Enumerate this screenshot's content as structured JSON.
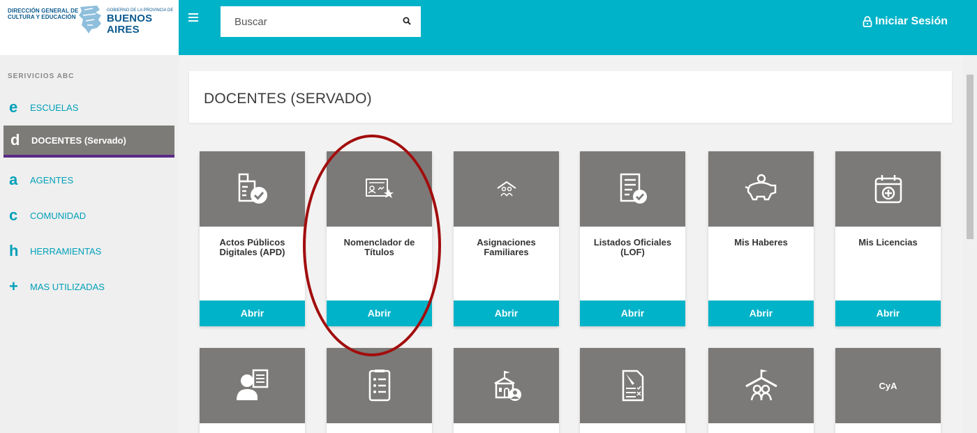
{
  "brand": {
    "left_line1": "DIRECCIÓN GENERAL DE",
    "left_line2": "CULTURA Y EDUCACIÓN",
    "right_small": "GOBIERNO DE LA PROVINCIA DE",
    "right_big": "BUENOS AIRES"
  },
  "sidebar": {
    "section_label": "SERIVICIOS ABC",
    "items": [
      {
        "letter": "e",
        "label": "ESCUELAS"
      },
      {
        "letter": "d",
        "label": "DOCENTES (Servado)"
      },
      {
        "letter": "a",
        "label": "AGENTES"
      },
      {
        "letter": "c",
        "label": "COMUNIDAD"
      },
      {
        "letter": "h",
        "label": "HERRAMIENTAS"
      },
      {
        "letter": "+",
        "label": "MAS UTILIZADAS"
      }
    ]
  },
  "topbar": {
    "search_placeholder": "Buscar",
    "login_label": "Iniciar Sesión"
  },
  "page": {
    "title": "DOCENTES (SERVADO)"
  },
  "cards": [
    {
      "label": "Actos Públicos Digitales (APD)",
      "button": "Abrir",
      "icon": "id-badge-check-icon"
    },
    {
      "label": "Nomenclador de Títulos",
      "button": "Abrir",
      "icon": "certificate-star-icon"
    },
    {
      "label": "Asignaciones Familiares",
      "button": "Abrir",
      "icon": "family-house-icon"
    },
    {
      "label": "Listados Oficiales (LOF)",
      "button": "Abrir",
      "icon": "list-check-icon"
    },
    {
      "label": "Mis Haberes",
      "button": "Abrir",
      "icon": "piggy-bank-icon"
    },
    {
      "label": "Mis Licencias",
      "button": "Abrir",
      "icon": "calendar-plus-icon"
    }
  ],
  "cards_row2": [
    {
      "icon": "person-document-icon"
    },
    {
      "icon": "document-list-icon"
    },
    {
      "icon": "school-person-icon"
    },
    {
      "icon": "document-checklist-icon"
    },
    {
      "icon": "school-roof-people-icon"
    },
    {
      "icon": "cya-text-icon",
      "text": "CyA"
    }
  ],
  "colors": {
    "accent": "#00b3c8",
    "card_head": "#7b7a78",
    "active_nav": "#7d7b78",
    "active_underline": "#5b2a87",
    "annotation_circle": "#a20d0d"
  }
}
